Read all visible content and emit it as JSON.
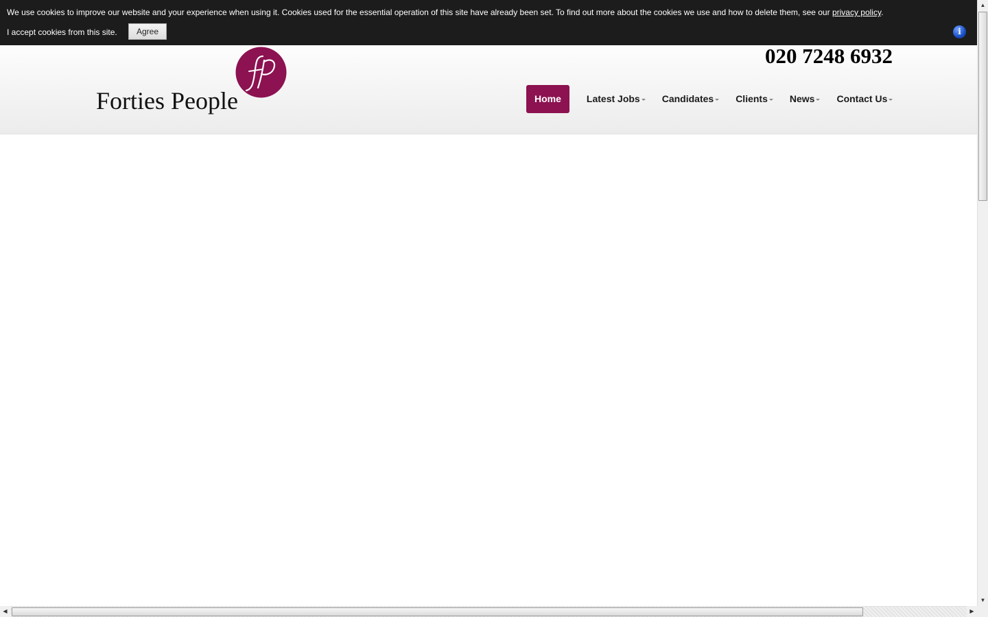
{
  "cookie_bar": {
    "message": "We use cookies to improve our website and your experience when using it. Cookies used for the essential operation of this site have already been set. To find out more about the cookies we use and how to delete them, see our ",
    "link_label": "privacy policy",
    "message_end": ".",
    "accept_text": "I accept cookies from this site.",
    "agree_label": "Agree",
    "info_glyph": "i",
    "background": "#1c1c1c"
  },
  "header": {
    "brand_name": "Forties People",
    "logo_text": "fp",
    "logo_color": "#8c1251",
    "phone": "020 7248 6932"
  },
  "nav": {
    "accent": "#8c1251",
    "items": [
      {
        "label": "Home",
        "active": true
      },
      {
        "label": "Latest Jobs",
        "dropdown": true
      },
      {
        "label": "Candidates",
        "dropdown": true
      },
      {
        "label": "Clients",
        "dropdown": true
      },
      {
        "label": "News",
        "dropdown": true
      },
      {
        "label": "Contact Us",
        "dropdown": true
      }
    ]
  },
  "scrollbars": {
    "up": "▲",
    "down": "▼",
    "left": "◀",
    "right": "▶"
  }
}
